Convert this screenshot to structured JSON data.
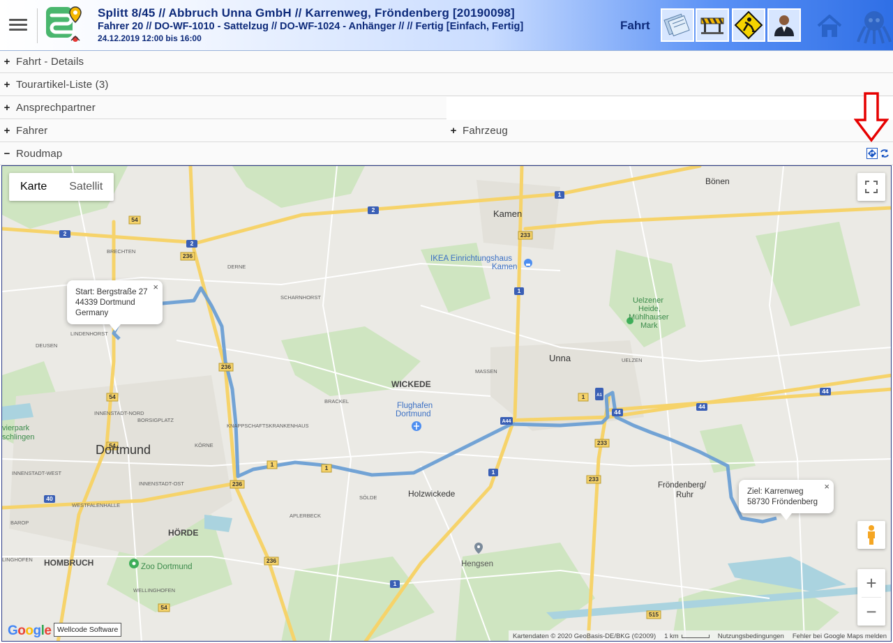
{
  "header": {
    "title_line1": "Splitt 8/45 // Abbruch Unna GmbH // Karrenweg, Fröndenberg [20190098]",
    "title_line2": "Fahrer 20 // DO-WF-1010 - Sattelzug // DO-WF-1024 - Anhänger // // Fertig [Einfach, Fertig]",
    "title_line3": "24.12.2019 12:00 bis 16:00",
    "section_label": "Fahrt",
    "tools": [
      "document-icon",
      "barrier-icon",
      "roadwork-icon",
      "person-icon"
    ]
  },
  "sections": {
    "fahrt_details": {
      "toggle": "+",
      "label": "Fahrt - Details"
    },
    "tourartikel": {
      "toggle": "+",
      "label": "Tourartikel-Liste (3)"
    },
    "ansprechpartner": {
      "toggle": "+",
      "label": "Ansprechpartner"
    },
    "fahrer": {
      "toggle": "+",
      "label": "Fahrer"
    },
    "fahrzeug": {
      "toggle": "+",
      "label": "Fahrzeug"
    },
    "roudmap": {
      "toggle": "−",
      "label": "Roudmap"
    }
  },
  "map": {
    "type_buttons": {
      "karte": "Karte",
      "satellit": "Satellit"
    },
    "zoom_in": "+",
    "zoom_out": "−",
    "start_info": {
      "line1": "Start: Bergstraße 27",
      "line2": "44339 Dortmund",
      "line3": "Germany"
    },
    "end_info": {
      "line1": "Ziel: Karrenweg",
      "line2": "58730 Fröndenberg"
    },
    "close": "×",
    "google_logo": "Google",
    "watermark": "Wellcode Software",
    "attribution": {
      "data": "Kartendaten © 2020 GeoBasis-DE/BKG (©2009)",
      "scale": "1 km",
      "terms": "Nutzungsbedingungen",
      "report": "Fehler bei Google Maps melden"
    },
    "places": {
      "dortmund": "Dortmund",
      "unna": "Unna",
      "kamen": "Kamen",
      "boenen": "Bönen",
      "wickede": "WICKEDE",
      "hoerde": "HÖRDE",
      "hombruch": "HOMBRUCH",
      "holzwickede": "Holzwickede",
      "froendenberg1": "Fröndenberg/",
      "froendenberg2": "Ruhr",
      "hengsen": "Hengsen",
      "flughafen1": "Flughafen",
      "flughafen2": "Dortmund",
      "ikea1": "IKEA Einrichtungshaus",
      "ikea2": "Kamen",
      "zoo": "Zoo Dortmund",
      "uelzener1": "Uelzener",
      "uelzener2": "Heide,",
      "uelzener3": "Mühlhauser",
      "uelzener4": "Mark",
      "brechten": "BRECHTEN",
      "derne": "DERNE",
      "scharnhorst": "SCHARNHORST",
      "lindenhorst": "LINDENHORST",
      "deusen": "DEUSEN",
      "innenstadt_nord": "INNENSTADT-NORD",
      "borsigplatz": "BORSIGPLATZ",
      "knappschaft": "KNAPPSCHAFTSKRANKENHAUS",
      "koerne": "KÖRNE",
      "brackel": "BRACKEL",
      "massen": "MASSEN",
      "uelzen": "UELZEN",
      "innenstadt_west": "INNENSTADT-WEST",
      "innenstadt_ost": "INNENSTADT-OST",
      "westfalenhalle": "WESTFALENHALLE",
      "barop": "BAROP",
      "aplerbeck": "APLERBECK",
      "soelde": "SÖLDE",
      "lingh": "LINGHOFEN",
      "wellinghofen": "WELLINGHOFEN",
      "parkpart1": "vierpark",
      "parkpart2": "schlingen"
    },
    "road_shields": [
      "2",
      "2",
      "2",
      "1",
      "1",
      "1",
      "1",
      "1",
      "1",
      "1",
      "54",
      "54",
      "54",
      "54",
      "233",
      "233",
      "233",
      "236",
      "236",
      "236",
      "236",
      "40",
      "44",
      "44",
      "44",
      "515",
      "A1",
      "A44"
    ]
  },
  "colors": {
    "route": "#6b9fd4",
    "header_end": "#2f6fe6",
    "header_text": "#0d2a7a",
    "annotation_arrow": "#e60000"
  }
}
